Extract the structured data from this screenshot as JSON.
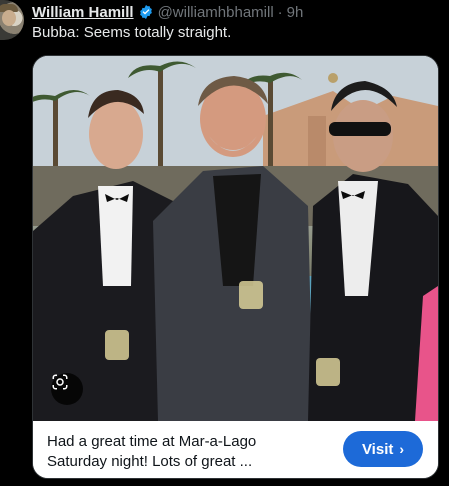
{
  "tweet": {
    "author_name": "William Hamill",
    "author_handle": "@williamhbhamill",
    "separator": "·",
    "time": "9h",
    "text": "Bubba: Seems totally straight.",
    "verified": true
  },
  "card": {
    "image_icon": "camera-lens-icon",
    "title": "Had a great time at Mar-a-Lago Saturday night! Lots of great ...",
    "visit_label": "Visit",
    "visit_arrow": "›",
    "accent_color": "#1d6ad8"
  },
  "colors": {
    "background": "#000000",
    "text_primary": "#e7e9ea",
    "text_secondary": "#71767b",
    "verified_blue": "#1d9bf0"
  }
}
